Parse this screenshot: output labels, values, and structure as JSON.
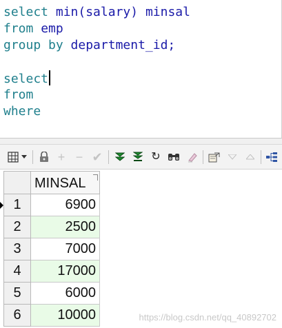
{
  "editor": {
    "lines": [
      {
        "kw1": "select",
        "id1": "min(salary)",
        "id2": "minsal"
      },
      {
        "kw1": "from",
        "id1": "emp"
      },
      {
        "kw1": "group by",
        "id1": "department_id;"
      },
      {},
      {
        "kw1": "select"
      },
      {
        "kw1": "from"
      },
      {
        "kw1": "where"
      }
    ]
  },
  "toolbar": {
    "icons": [
      "grid-view-icon",
      "dropdown-arrow-icon",
      "lock-icon",
      "add-record-icon",
      "delete-record-icon",
      "post-edit-icon",
      "fetch-next-icon",
      "fetch-last-icon",
      "refresh-icon",
      "find-icon",
      "clear-icon",
      "export-icon",
      "sort-desc-icon",
      "sort-asc-icon",
      "query-plan-icon"
    ],
    "glyphs": {
      "add": "+",
      "minus": "−",
      "check": "✔",
      "refresh": "↻"
    }
  },
  "grid": {
    "column_header": "MINSAL",
    "row_numbers": [
      "1",
      "2",
      "3",
      "4",
      "5",
      "6"
    ],
    "values": [
      "6900",
      "2500",
      "7000",
      "17000",
      "6000",
      "10000"
    ],
    "alt_row_color": "#e9fbe7",
    "current_row": 1
  },
  "watermark": "https://blog.csdn.net/qq_40892702"
}
